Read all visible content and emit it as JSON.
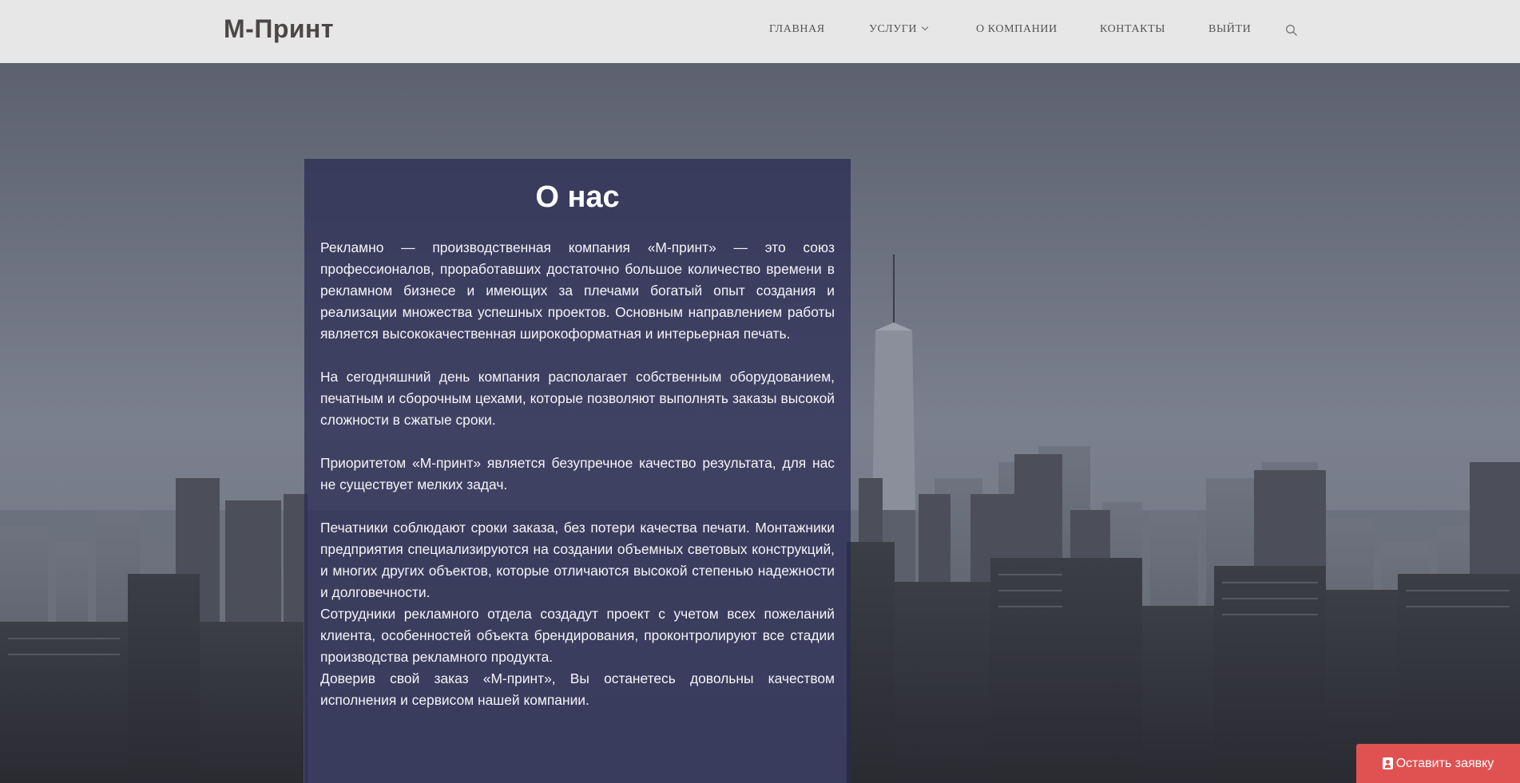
{
  "site": {
    "logo": "М-Принт"
  },
  "nav": {
    "items": [
      {
        "label": "ГЛАВНАЯ"
      },
      {
        "label": "УСЛУГИ"
      },
      {
        "label": "О КОМПАНИИ"
      },
      {
        "label": "КОНТАКТЫ"
      },
      {
        "label": "ВЫЙТИ"
      }
    ],
    "search_icon": "search-icon"
  },
  "about": {
    "title": "О нас",
    "paragraphs": [
      "Рекламно — производственная компания «М-принт» — это союз профессионалов, проработавших достаточно большое количество времени в рекламном бизнесе и имеющих за плечами богатый опыт создания и реализации множества успешных проектов. Основным направлением работы является высококачественная широкоформатная и интерьерная печать.",
      "На сегодняшний день компания располагает собственным оборудованием, печатным и сборочным цехами, которые позволяют выполнять заказы высокой сложности в сжатые сроки.",
      "Приоритетом «М-принт» является безупречное качество результата, для нас не существует мелких задач.",
      "Печатники соблюдают сроки заказа, без потери качества печати. Монтажники предприятия специализируются на создании объемных световых конструкций, и многих других объектов, которые отличаются высокой степенью надежности и долговечности.",
      "Сотрудники рекламного отдела создадут проект с учетом всех пожеланий клиента, особенностей объекта брендирования, проконтролируют все стадии производства рекламного продукта.",
      "Доверив свой заказ «М-принт», Вы останетесь довольны качеством исполнения и сервисом нашей компании."
    ]
  },
  "cta": {
    "label": "Оставить заявку",
    "icon": "user-badge-icon",
    "color": "#e05252"
  },
  "colors": {
    "header_bg": "#e7e7e7",
    "panel_bg": "#282a52",
    "logo": "#4b4747"
  }
}
